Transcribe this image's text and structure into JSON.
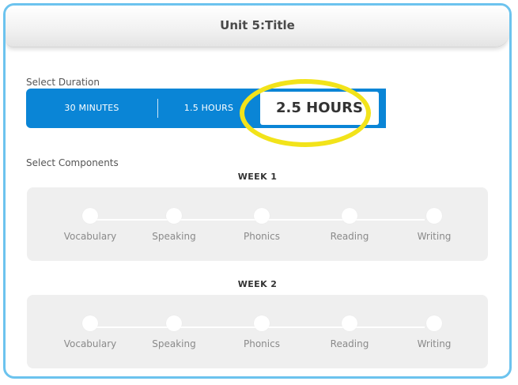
{
  "header": {
    "title": "Unit 5:Title"
  },
  "duration": {
    "label": "Select Duration",
    "options": [
      "30 MINUTES",
      "1.5 HOURS",
      "2.5 HOURS"
    ],
    "selected": "2.5 HOURS"
  },
  "components": {
    "label": "Select Components",
    "weeks": [
      {
        "label": "WEEK 1",
        "items": [
          "Vocabulary",
          "Speaking",
          "Phonics",
          "Reading",
          "Writing"
        ]
      },
      {
        "label": "WEEK 2",
        "items": [
          "Vocabulary",
          "Speaking",
          "Phonics",
          "Reading",
          "Writing"
        ]
      }
    ]
  },
  "colors": {
    "accent": "#0a85d6",
    "frame_border": "#6cc3ee",
    "highlight": "#f2e31a",
    "panel": "#efefef"
  }
}
